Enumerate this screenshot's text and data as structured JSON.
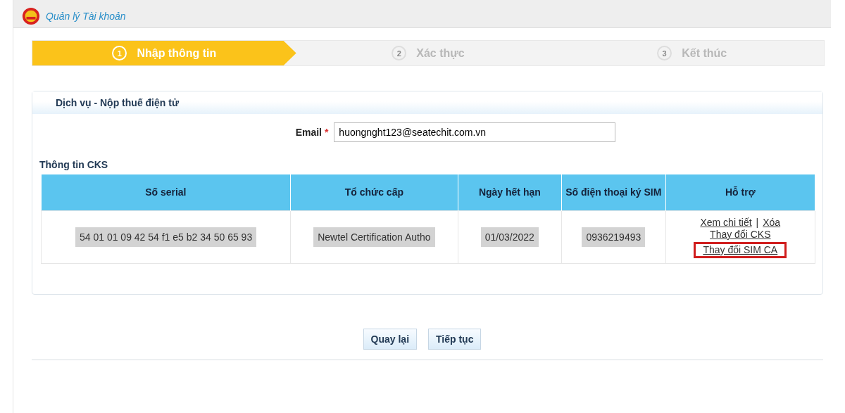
{
  "header": {
    "title": "Quản lý Tài khoản"
  },
  "steps": [
    {
      "number": "1",
      "label": "Nhập thông tin",
      "selected": true
    },
    {
      "number": "2",
      "label": "Xác thực",
      "selected": false
    },
    {
      "number": "3",
      "label": "Kết thúc",
      "selected": false
    }
  ],
  "section": {
    "title": "Dịch vụ - Nộp thuế điện tử"
  },
  "email": {
    "label": "Email",
    "required_mark": "*",
    "value": "huongnght123@seatechit.com.vn"
  },
  "cks": {
    "title": "Thông tin CKS",
    "table": {
      "columns": [
        "Số serial",
        "Tổ chức cấp",
        "Ngày hết hạn",
        "Số điện thoại ký SIM",
        "Hỗ trợ"
      ],
      "rows": [
        {
          "cells": [
            "54 01 01 09 42 54 f1 e5 b2 34 50 65 93",
            "Newtel Certification Autho",
            "01/03/2022",
            "0936219493"
          ],
          "separator": "|",
          "links": [
            {
              "label": "Xem chi tiết",
              "highlighted": false
            },
            {
              "label": "Xóa",
              "highlighted": false
            },
            {
              "label": "Thay đổi CKS",
              "highlighted": false
            },
            {
              "label": "Thay đổi SIM CA",
              "highlighted": true
            }
          ]
        }
      ]
    }
  },
  "buttons": [
    "Quay lại",
    "Tiếp tục"
  ]
}
